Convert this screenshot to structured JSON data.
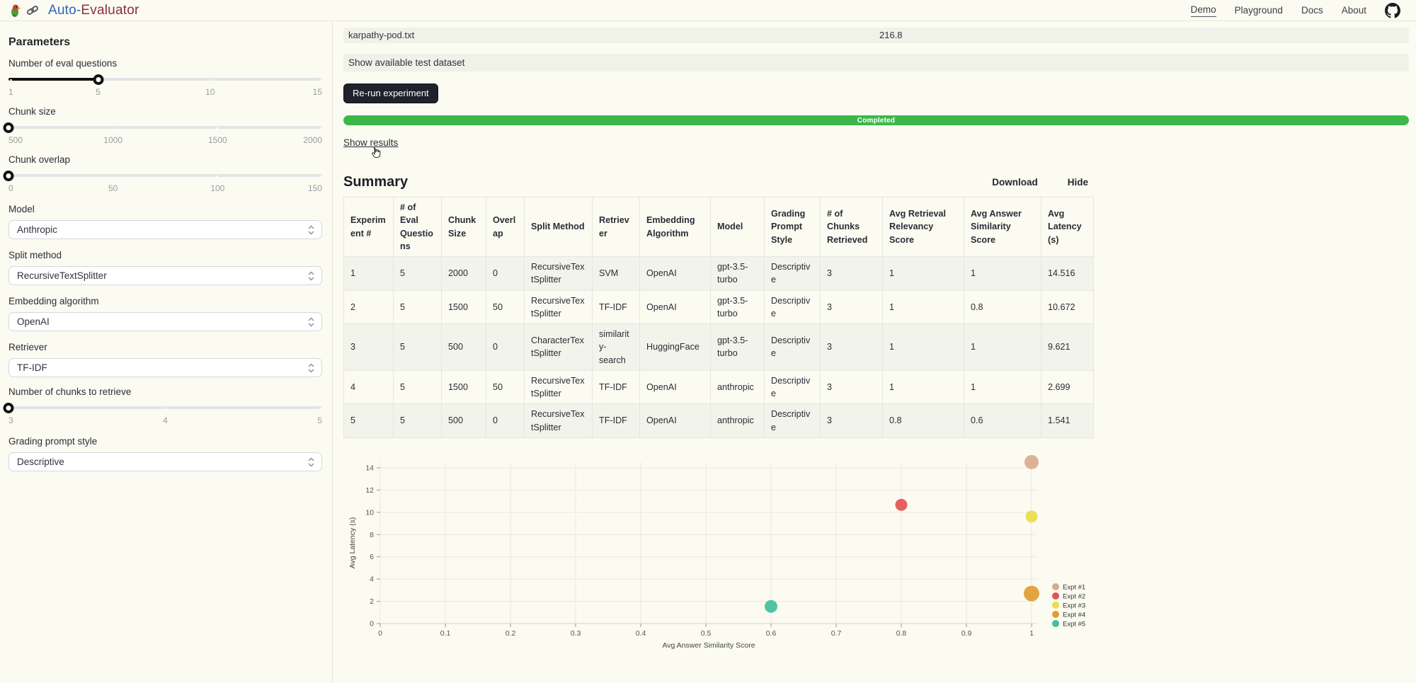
{
  "navbar": {
    "brand": {
      "auto": "Auto-",
      "evaluator": "Evaluator"
    },
    "links": [
      "Demo",
      "Playground",
      "Docs",
      "About"
    ],
    "active_link": "Demo"
  },
  "sidebar": {
    "title": "Parameters",
    "sliders": [
      {
        "label": "Number of eval questions",
        "ticks": [
          "1",
          "5",
          "10",
          "15"
        ],
        "value": 5
      },
      {
        "label": "Chunk size",
        "ticks": [
          "500",
          "1000",
          "1500",
          "2000"
        ],
        "value": 500
      },
      {
        "label": "Chunk overlap",
        "ticks": [
          "0",
          "50",
          "100",
          "150"
        ],
        "value": 0
      },
      {
        "label": "Number of chunks to retrieve",
        "ticks": [
          "3",
          "4",
          "5"
        ],
        "value": 3
      }
    ],
    "selects": [
      {
        "label": "Model",
        "value": "Anthropic"
      },
      {
        "label": "Split method",
        "value": "RecursiveTextSplitter"
      },
      {
        "label": "Embedding algorithm",
        "value": "OpenAI"
      },
      {
        "label": "Retriever",
        "value": "TF-IDF"
      },
      {
        "label": "Grading prompt style",
        "value": "Descriptive"
      }
    ]
  },
  "main": {
    "file_row": {
      "filename": "karpathy-pod.txt",
      "value": "216.8"
    },
    "expander_label": "Show available test dataset",
    "rerun_label": "Re-run experiment",
    "progress": {
      "label": "Completed",
      "percent": 100,
      "color": "#3cb848"
    },
    "show_results_label": "Show results",
    "summary": {
      "title": "Summary",
      "download_label": "Download",
      "hide_label": "Hide"
    }
  },
  "table": {
    "columns": [
      "Experiment #",
      "# of Eval Questions",
      "Chunk Size",
      "Overlap",
      "Split Method",
      "Retriever",
      "Embedding Algorithm",
      "Model",
      "Grading Prompt Style",
      "# of Chunks Retrieved",
      "Avg Retrieval Relevancy Score",
      "Avg Answer Similarity Score",
      "Avg Latency (s)"
    ],
    "rows": [
      [
        "1",
        "5",
        "2000",
        "0",
        "RecursiveTextSplitter",
        "SVM",
        "OpenAI",
        "gpt-3.5-turbo",
        "Descriptive",
        "3",
        "1",
        "1",
        "14.516"
      ],
      [
        "2",
        "5",
        "1500",
        "50",
        "RecursiveTextSplitter",
        "TF-IDF",
        "OpenAI",
        "gpt-3.5-turbo",
        "Descriptive",
        "3",
        "1",
        "0.8",
        "10.672"
      ],
      [
        "3",
        "5",
        "500",
        "0",
        "CharacterTextSplitter",
        "similarity-search",
        "HuggingFace",
        "gpt-3.5-turbo",
        "Descriptive",
        "3",
        "1",
        "1",
        "9.621"
      ],
      [
        "4",
        "5",
        "1500",
        "50",
        "RecursiveTextSplitter",
        "TF-IDF",
        "OpenAI",
        "anthropic",
        "Descriptive",
        "3",
        "1",
        "1",
        "2.699"
      ],
      [
        "5",
        "5",
        "500",
        "0",
        "RecursiveTextSplitter",
        "TF-IDF",
        "OpenAI",
        "anthropic",
        "Descriptive",
        "3",
        "0.8",
        "0.6",
        "1.541"
      ]
    ]
  },
  "chart_data": {
    "type": "scatter",
    "title": "",
    "xlabel": "Avg Answer Similarity Score",
    "ylabel": "Avg Latency (s)",
    "xlim": [
      0,
      1
    ],
    "ylim": [
      0,
      14
    ],
    "x_ticks": [
      "0",
      "0.1",
      "0.2",
      "0.3",
      "0.4",
      "0.5",
      "0.6",
      "0.7",
      "0.8",
      "0.9",
      "1"
    ],
    "y_ticks": [
      0,
      2,
      4,
      6,
      8,
      10,
      12,
      14
    ],
    "grid": true,
    "legend_position": "right",
    "series": [
      {
        "name": "Expt #1",
        "color": "#d9ab8e",
        "size": 10,
        "points": [
          {
            "x": 1,
            "y": 14.516
          }
        ]
      },
      {
        "name": "Expt #2",
        "color": "#e4524e",
        "size": 8.5,
        "points": [
          {
            "x": 0.8,
            "y": 10.672
          }
        ]
      },
      {
        "name": "Expt #3",
        "color": "#e9dc4b",
        "size": 8.5,
        "points": [
          {
            "x": 1,
            "y": 9.621
          }
        ]
      },
      {
        "name": "Expt #4",
        "color": "#e09c32",
        "size": 11,
        "points": [
          {
            "x": 1,
            "y": 2.699
          }
        ]
      },
      {
        "name": "Expt #5",
        "color": "#3fbf9e",
        "size": 9,
        "points": [
          {
            "x": 0.6,
            "y": 1.541
          }
        ]
      }
    ]
  }
}
